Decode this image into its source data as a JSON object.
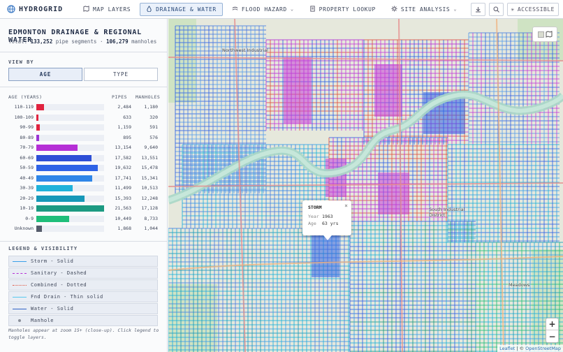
{
  "app": {
    "name": "HYDROGRID"
  },
  "nav": [
    {
      "label": "MAP LAYERS",
      "icon": "map-icon",
      "active": false,
      "dropdown": false
    },
    {
      "label": "DRAINAGE & WATER",
      "icon": "water-icon",
      "active": true,
      "dropdown": false
    },
    {
      "label": "FLOOD HAZARD",
      "icon": "flood-icon",
      "active": false,
      "dropdown": true
    },
    {
      "label": "PROPERTY LOOKUP",
      "icon": "document-icon",
      "active": false,
      "dropdown": false
    },
    {
      "label": "SITE ANALYSIS",
      "icon": "gear-icon",
      "active": false,
      "dropdown": true
    }
  ],
  "tools": {
    "accessible_label": "ACCESSIBLE"
  },
  "panel": {
    "title": "EDMONTON DRAINAGE & REGIONAL WATER",
    "total_prefix": "Total: ",
    "pipe_segments": "133,252",
    "pipe_segments_suffix": " pipe segments · ",
    "manholes": "106,279",
    "manholes_suffix": " manholes",
    "view_by_label": "VIEW BY",
    "view_options": [
      "AGE",
      "TYPE"
    ],
    "table_headers": {
      "age": "AGE (YEARS)",
      "pipes": "PIPES",
      "manholes": "MANHOLES"
    },
    "age_rows": [
      {
        "label": "110-119",
        "pipes": "2,484",
        "manholes": "1,180",
        "fraction": 0.115,
        "color": "#e0233f"
      },
      {
        "label": "100-109",
        "pipes": "633",
        "manholes": "320",
        "fraction": 0.03,
        "color": "#e0233f"
      },
      {
        "label": "90-99",
        "pipes": "1,159",
        "manholes": "591",
        "fraction": 0.054,
        "color": "#e0233f"
      },
      {
        "label": "80-89",
        "pipes": "895",
        "manholes": "576",
        "fraction": 0.042,
        "color": "#9a34d4"
      },
      {
        "label": "70-79",
        "pipes": "13,154",
        "manholes": "9,640",
        "fraction": 0.61,
        "color": "#b52fd6"
      },
      {
        "label": "60-69",
        "pipes": "17,582",
        "manholes": "13,551",
        "fraction": 0.815,
        "color": "#2e4fd6"
      },
      {
        "label": "50-59",
        "pipes": "19,632",
        "manholes": "15,478",
        "fraction": 0.91,
        "color": "#2f63e6"
      },
      {
        "label": "40-49",
        "pipes": "17,741",
        "manholes": "15,341",
        "fraction": 0.823,
        "color": "#2f86e8"
      },
      {
        "label": "30-39",
        "pipes": "11,499",
        "manholes": "10,513",
        "fraction": 0.533,
        "color": "#1fb2da"
      },
      {
        "label": "20-29",
        "pipes": "15,393",
        "manholes": "12,248",
        "fraction": 0.714,
        "color": "#1698b8"
      },
      {
        "label": "10-19",
        "pipes": "21,563",
        "manholes": "17,128",
        "fraction": 1.0,
        "color": "#1c9a82"
      },
      {
        "label": "0-9",
        "pipes": "10,449",
        "manholes": "8,733",
        "fraction": 0.485,
        "color": "#1fbe7a"
      },
      {
        "label": "Unknown",
        "pipes": "1,868",
        "manholes": "1,044",
        "fraction": 0.087,
        "color": "#555c6b"
      }
    ],
    "legend_title": "LEGEND & VISIBILITY",
    "legend": [
      {
        "label": "Storm - Solid",
        "color": "#3aa0e8",
        "style": "solid"
      },
      {
        "label": "Sanitary - Dashed",
        "color": "#b52fd6",
        "style": "dashed"
      },
      {
        "label": "Combined - Dotted",
        "color": "#e0533f",
        "style": "dotted"
      },
      {
        "label": "Fnd Drain - Thin solid",
        "color": "#58c8ee",
        "style": "thin"
      },
      {
        "label": "Water - Solid",
        "color": "#2f63c6",
        "style": "solid"
      },
      {
        "label": "Manhole",
        "color": "#8a8f99",
        "style": "dot"
      }
    ],
    "note": "Manholes appear at zoom 15+ (close-up). Click legend to toggle layers."
  },
  "map": {
    "labels": [
      "Northwest Industrial",
      "South Industrial District",
      "Meadows"
    ],
    "popup": {
      "title": "STORM",
      "year_label": "Year",
      "year": "1963",
      "age_label": "Age",
      "age": "63 yrs"
    },
    "zoom_in": "+",
    "zoom_out": "−",
    "attribution_leaflet": "Leaflet",
    "attribution_sep": " | © ",
    "attribution_osm": "OpenStreetMap"
  }
}
